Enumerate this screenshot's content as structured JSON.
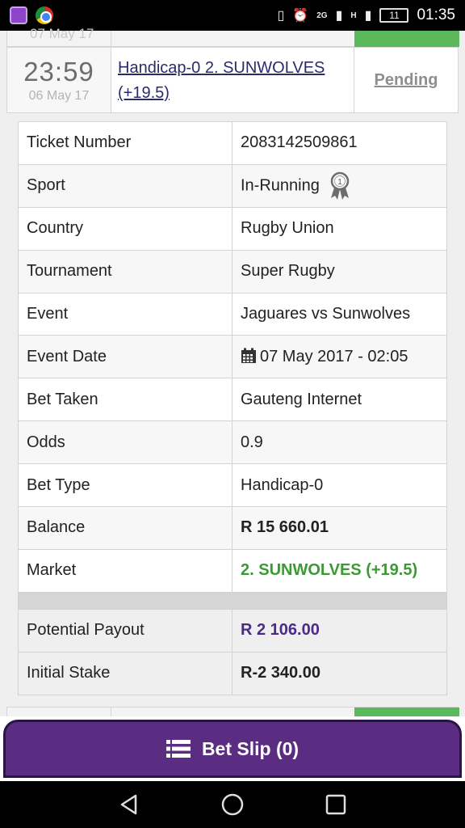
{
  "status_bar": {
    "network_2g": "2G",
    "network_h": "H",
    "battery": "11",
    "time": "01:35"
  },
  "prev_card": {
    "date_partial": "07 May 17"
  },
  "bet": {
    "time": "23:59",
    "date": "06 May 17",
    "selection": "Handicap-0 2. SUNWOLVES (+19.5)",
    "status": "Pending"
  },
  "details": {
    "ticket_number": {
      "label": "Ticket Number",
      "value": "2083142509861"
    },
    "sport": {
      "label": "Sport",
      "value": "In-Running"
    },
    "country": {
      "label": "Country",
      "value": "Rugby Union"
    },
    "tournament": {
      "label": "Tournament",
      "value": "Super Rugby"
    },
    "event": {
      "label": "Event",
      "value": "Jaguares vs Sunwolves"
    },
    "event_date": {
      "label": "Event Date",
      "value": "07 May 2017 - 02:05"
    },
    "bet_taken": {
      "label": "Bet Taken",
      "value": "Gauteng Internet"
    },
    "odds": {
      "label": "Odds",
      "value": "0.9"
    },
    "bet_type": {
      "label": "Bet Type",
      "value": "Handicap-0"
    },
    "balance": {
      "label": "Balance",
      "value": "R 15 660.01"
    },
    "market": {
      "label": "Market",
      "value": "2. SUNWOLVES (+19.5)"
    },
    "potential_payout": {
      "label": "Potential Payout",
      "value": "R 2 106.00"
    },
    "initial_stake": {
      "label": "Initial Stake",
      "value": "R-2 340.00"
    }
  },
  "bet_slip": {
    "label": "Bet Slip (0)"
  },
  "icons": {
    "trophy": "medal-1-icon",
    "calendar": "calendar-icon",
    "list": "list-icon"
  },
  "colors": {
    "market_green": "#3c9a34",
    "payout_purple": "#4b2a8a",
    "betslip_bg": "#5b2d82",
    "pending_gray": "#8e8e8e"
  }
}
